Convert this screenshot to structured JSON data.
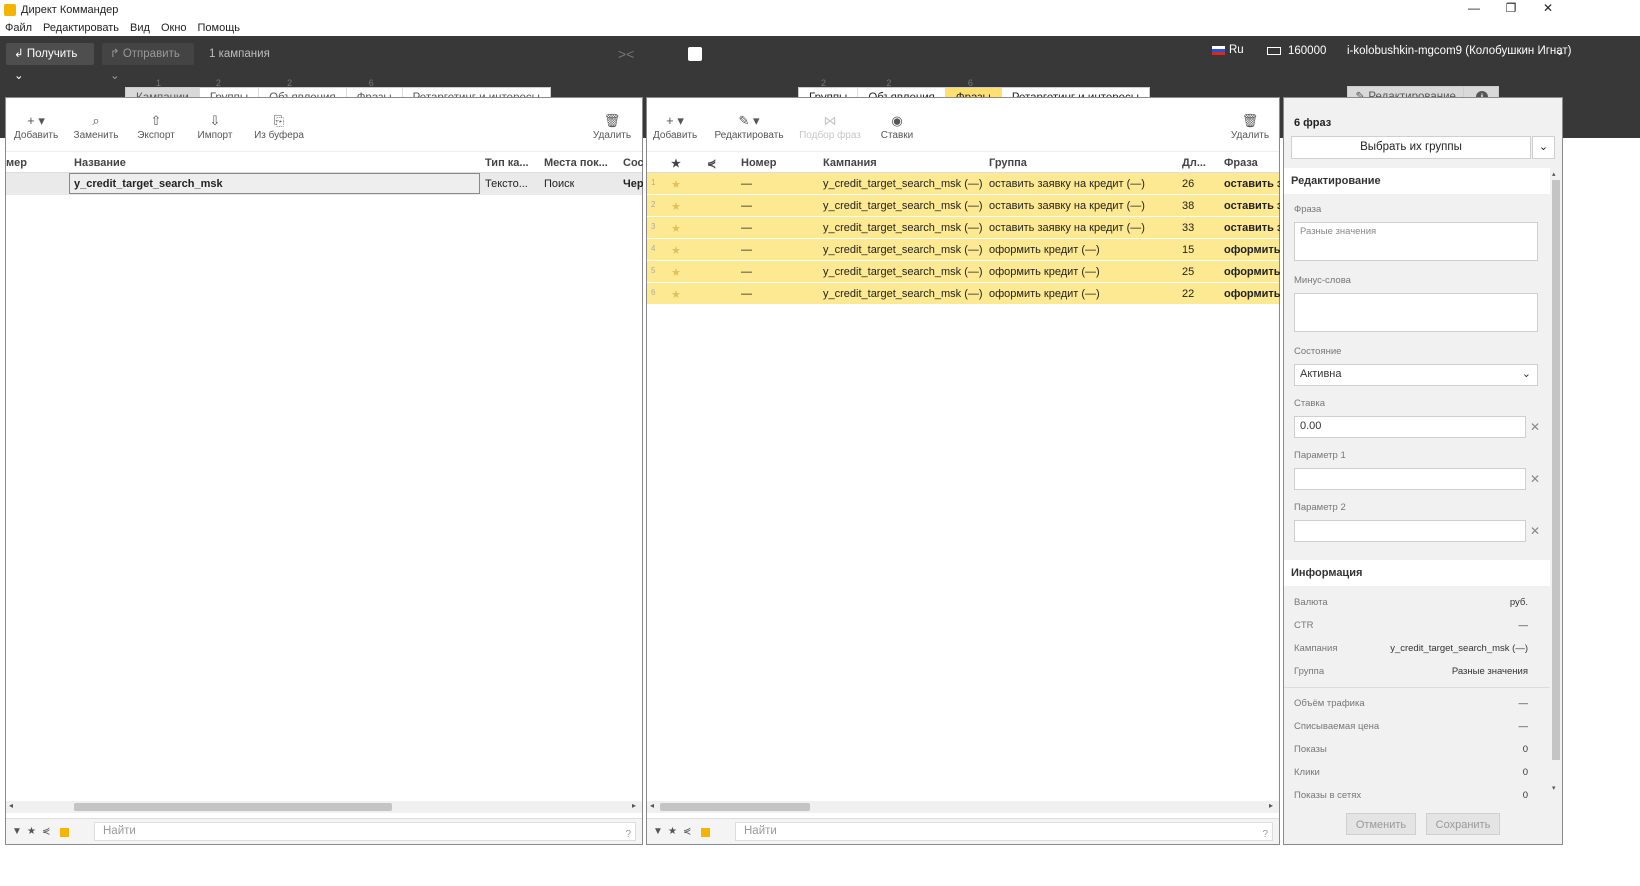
{
  "window": {
    "title": "Директ Коммандер",
    "controls": [
      "—",
      "❐",
      "✕"
    ]
  },
  "menu": [
    "Файл",
    "Редактировать",
    "Вид",
    "Окно",
    "Помощь"
  ],
  "toolbar": {
    "get_label": "Получить",
    "send_label": "Отправить",
    "campaigns_count": "1 кампания",
    "lang": "Ru",
    "balance": "160000",
    "user": "i-kolobushkin-mgcom9 (Колобушкин Игнат)"
  },
  "left_tabs": [
    {
      "label": "Кампании",
      "num": "1"
    },
    {
      "label": "Группы",
      "num": "2"
    },
    {
      "label": "Объявления",
      "num": "2"
    },
    {
      "label": "Фразы",
      "num": "6"
    },
    {
      "label": "Ретаргетинг и интересы",
      "num": ""
    }
  ],
  "right_tabs": [
    {
      "label": "Группы",
      "num": "2"
    },
    {
      "label": "Объявления",
      "num": "2"
    },
    {
      "label": "Фразы",
      "num": "6"
    },
    {
      "label": "Ретаргетинг и интересы",
      "num": ""
    }
  ],
  "left_tools": {
    "add": "Добавить",
    "replace": "Заменить",
    "export": "Экспорт",
    "import": "Импорт",
    "from_buffer": "Из буфера",
    "delete": "Удалить"
  },
  "left_table": {
    "headers": {
      "num": "мер",
      "name": "Название",
      "type": "Тип ка...",
      "places": "Места пок...",
      "state": "Сос"
    },
    "rows": [
      {
        "name": "y_credit_target_search_msk",
        "type": "Тексто...",
        "places": "Поиск",
        "state": "Чер"
      }
    ]
  },
  "mid_tools": {
    "add": "Добавить",
    "edit": "Редактировать",
    "phrase_pick": "Подбор фраз",
    "bids": "Ставки",
    "delete": "Удалить"
  },
  "mid_table": {
    "headers": {
      "star": "★",
      "status": "⋞",
      "num": "Номер",
      "campaign": "Кампания",
      "group": "Группа",
      "len": "Дл...",
      "phrase": "Фраза"
    },
    "rows": [
      {
        "idx": "1",
        "num": "—",
        "campaign": "y_credit_target_search_msk (—)",
        "group": "оставить заявку на кредит (—)",
        "len": "26",
        "phrase": "оставить з"
      },
      {
        "idx": "2",
        "num": "—",
        "campaign": "y_credit_target_search_msk (—)",
        "group": "оставить заявку на кредит (—)",
        "len": "38",
        "phrase": "оставить з"
      },
      {
        "idx": "3",
        "num": "—",
        "campaign": "y_credit_target_search_msk (—)",
        "group": "оставить заявку на кредит (—)",
        "len": "33",
        "phrase": "оставить з"
      },
      {
        "idx": "4",
        "num": "—",
        "campaign": "y_credit_target_search_msk (—)",
        "group": "оформить кредит (—)",
        "len": "15",
        "phrase": "оформить"
      },
      {
        "idx": "5",
        "num": "—",
        "campaign": "y_credit_target_search_msk (—)",
        "group": "оформить кредит (—)",
        "len": "25",
        "phrase": "оформить"
      },
      {
        "idx": "6",
        "num": "—",
        "campaign": "y_credit_target_search_msk (—)",
        "group": "оформить кредит (—)",
        "len": "22",
        "phrase": "оформить"
      }
    ]
  },
  "search_placeholder": "Найти",
  "search_help": "?",
  "right_panel": {
    "tab_edit": "Редактирование",
    "count": "6 фраз",
    "pick_groups": "Выбрать их группы",
    "edit_section": "Редактирование",
    "phrase_label": "Фраза",
    "phrase_value": "Разные значения",
    "minus_label": "Минус-слова",
    "state_label": "Состояние",
    "state_value": "Активна",
    "bid_label": "Ставка",
    "bid_value": "0.00",
    "param1_label": "Параметр 1",
    "param2_label": "Параметр 2",
    "info_section": "Информация",
    "info": [
      {
        "k": "Валюта",
        "v": "руб."
      },
      {
        "k": "CTR",
        "v": "—"
      },
      {
        "k": "Кампания",
        "v": "y_credit_target_search_msk (—)"
      },
      {
        "k": "Группа",
        "v": "Разные значения"
      },
      {
        "k": "Объём трафика",
        "v": "—"
      },
      {
        "k": "Списываемая цена",
        "v": "—"
      },
      {
        "k": "Показы",
        "v": "0"
      },
      {
        "k": "Клики",
        "v": "0"
      },
      {
        "k": "Показы в сетях",
        "v": "0"
      }
    ],
    "cancel": "Отменить",
    "save": "Сохранить"
  },
  "colors": {
    "toolbar_bg": "#383838",
    "row_highlight": "#fde991",
    "tab_active": "#ffe070"
  }
}
